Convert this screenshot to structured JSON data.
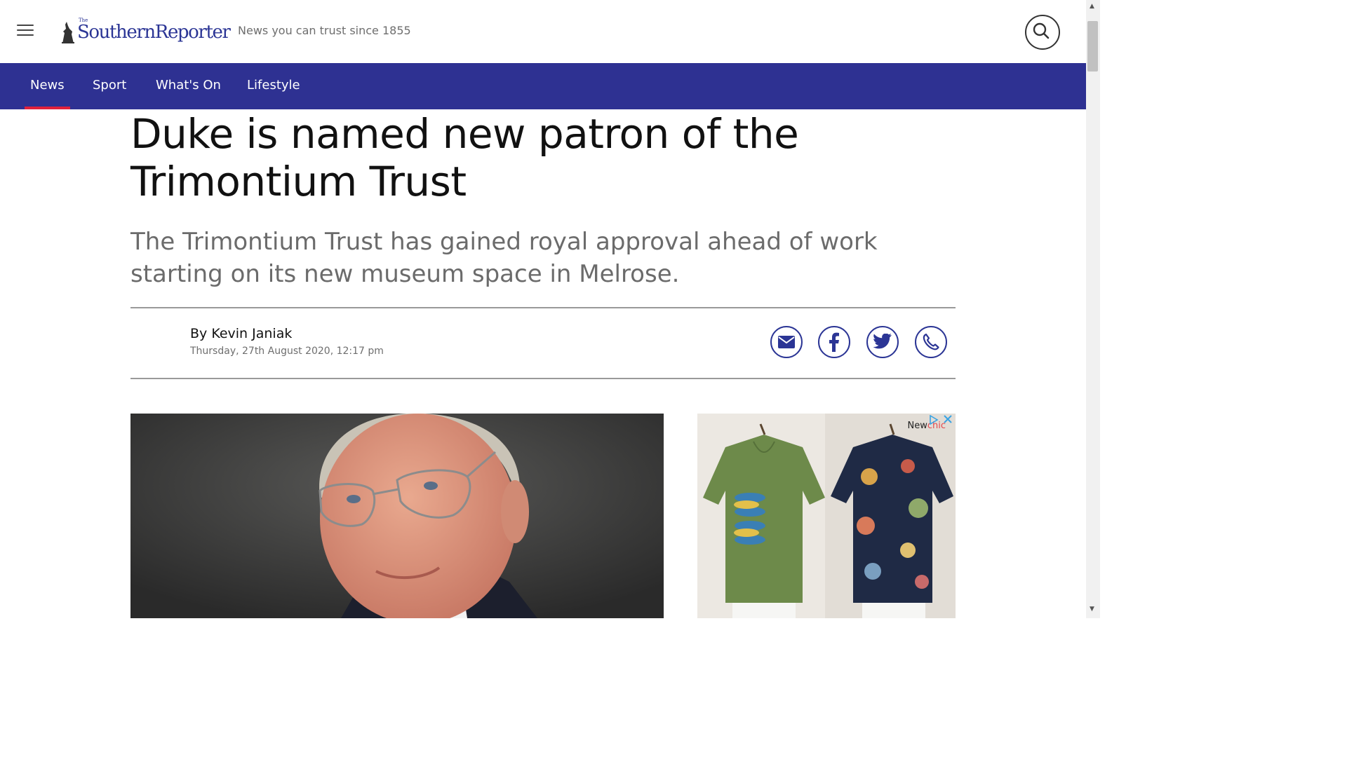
{
  "header": {
    "logo_small": "The",
    "logo": "SouthernReporter",
    "tagline": "News you can trust since 1855"
  },
  "nav": {
    "items": [
      {
        "label": "News",
        "active": true
      },
      {
        "label": "Sport"
      },
      {
        "label": "What's On"
      },
      {
        "label": "Lifestyle"
      }
    ]
  },
  "article": {
    "headline": "Duke is named new patron of the Trimontium Trust",
    "standfirst": "The Trimontium Trust has gained royal approval ahead of work starting on its new museum space in Melrose.",
    "byline": "By Kevin Janiak",
    "date": "Thursday, 27th August 2020, 12:17 pm"
  },
  "share": [
    "email-icon",
    "facebook-icon",
    "twitter-icon",
    "whatsapp-icon"
  ],
  "ad": {
    "brand_a": "New",
    "brand_b": "chic"
  },
  "colors": {
    "brand": "#2e3192",
    "accent": "#e1213b"
  }
}
